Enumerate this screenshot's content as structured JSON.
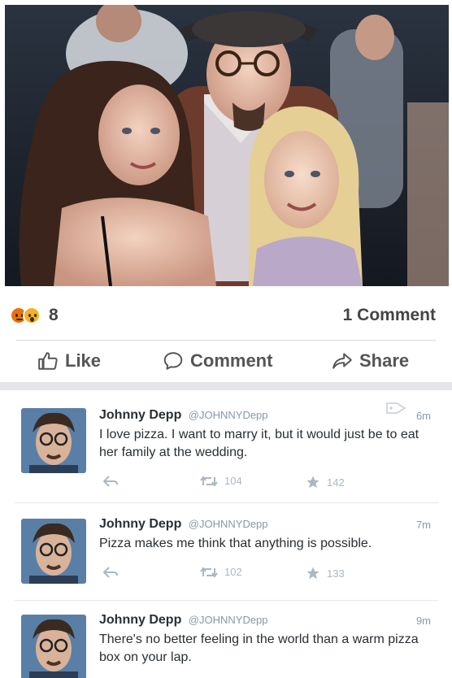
{
  "photo": {
    "description_icon": "photo"
  },
  "reactions": {
    "icons": [
      "angry-reaction-icon",
      "wow-reaction-icon"
    ],
    "count": "8",
    "comments": "1 Comment"
  },
  "actions": {
    "like": "Like",
    "comment": "Comment",
    "share": "Share"
  },
  "tweets": [
    {
      "name": "Johnny Depp",
      "handle": "@JOHNNYDepp",
      "time": "6m",
      "text": "I love pizza. I want to marry it, but it would just be to eat her family at the wedding.",
      "retweets": "104",
      "favorites": "142"
    },
    {
      "name": "Johnny Depp",
      "handle": "@JOHNNYDepp",
      "time": "7m",
      "text": "Pizza makes me think that anything is possible.",
      "retweets": "102",
      "favorites": "133"
    },
    {
      "name": "Johnny Depp",
      "handle": "@JOHNNYDepp",
      "time": "9m",
      "text": "There's no better feeling in the world than a warm pizza box on your lap."
    }
  ],
  "colors": {
    "accent": "#4267b2",
    "twitter_gray": "#8899a6"
  }
}
